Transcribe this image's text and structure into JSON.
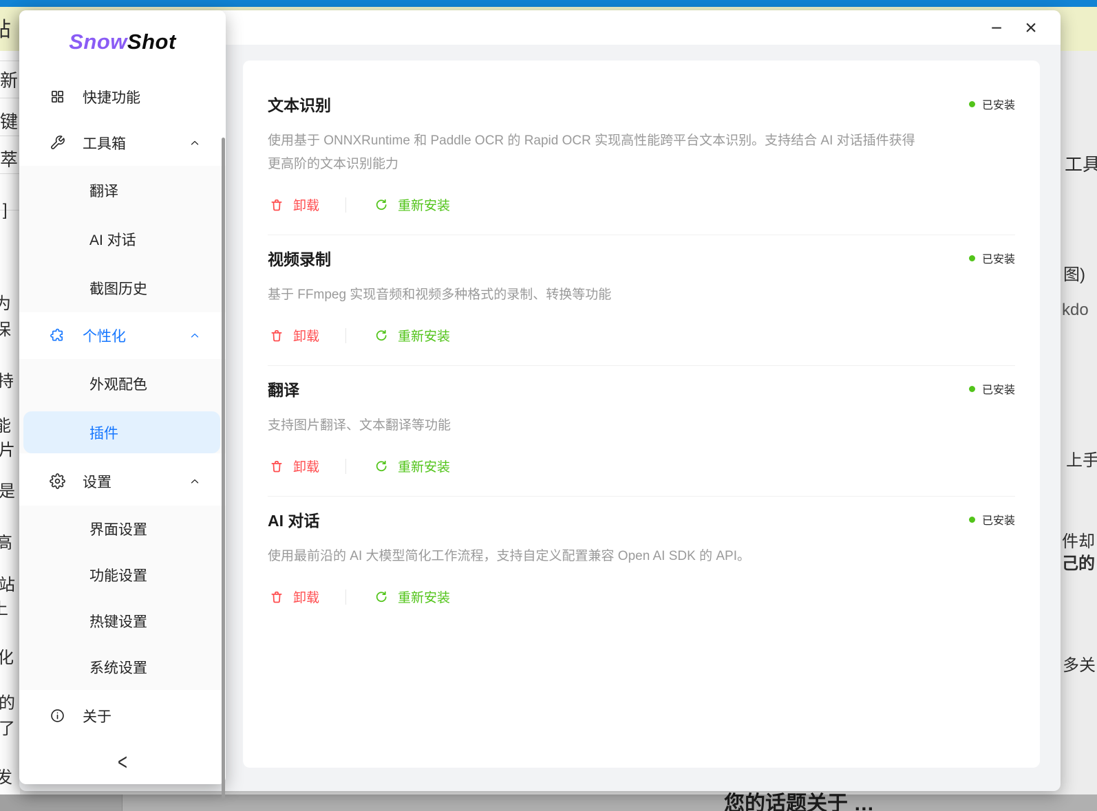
{
  "background": {
    "left_fragments": [
      "帖",
      "建新",
      "一键",
      "荟萃",
      "]",
      "为",
      "保",
      "支持",
      "能",
      "图片",
      "的是",
      "高",
      "前站",
      "上",
      "化",
      "适的",
      "出了",
      "发"
    ],
    "right_fragments": [
      "工具",
      "图)",
      "kdo",
      "上手",
      "件却",
      "己的",
      "多关"
    ],
    "bottom_band_text": "您的话题关于 …"
  },
  "window": {
    "controls": {
      "minimize": "−",
      "close": "×"
    }
  },
  "sidebar": {
    "logo": {
      "snow": "Snow",
      "shot": "Shot"
    },
    "items": [
      {
        "label": "快捷功能"
      },
      {
        "label": "工具箱"
      },
      {
        "label": "翻译"
      },
      {
        "label": "AI 对话"
      },
      {
        "label": "截图历史"
      },
      {
        "label": "个性化"
      },
      {
        "label": "外观配色"
      },
      {
        "label": "插件"
      },
      {
        "label": "设置"
      },
      {
        "label": "界面设置"
      },
      {
        "label": "功能设置"
      },
      {
        "label": "热键设置"
      },
      {
        "label": "系统设置"
      },
      {
        "label": "关于"
      }
    ],
    "collapse_label": "<"
  },
  "plugins": {
    "status_label": "已安装",
    "uninstall_label": "卸载",
    "reinstall_label": "重新安装",
    "cards": [
      {
        "title": "文本识别",
        "description": "使用基于 ONNXRuntime 和 Paddle OCR 的 Rapid OCR 实现高性能跨平台文本识别。支持结合 AI 对话插件获得更高阶的文本识别能力"
      },
      {
        "title": "视频录制",
        "description": "基于 FFmpeg 实现音频和视频多种格式的录制、转换等功能"
      },
      {
        "title": "翻译",
        "description": "支持图片翻译、文本翻译等功能"
      },
      {
        "title": "AI 对话",
        "description": "使用最前沿的 AI 大模型简化工作流程，支持自定义配置兼容 Open AI SDK 的 API。"
      }
    ]
  },
  "colors": {
    "accent_blue": "#1677ff",
    "selected_item_bg": "#e3f1fe",
    "danger_red": "#ff4d4f",
    "success_green": "#52c41a",
    "logo_purple": "#8a5cf5",
    "top_strip_blue": "#1283d4",
    "band_yellow": "#eef0c8"
  }
}
